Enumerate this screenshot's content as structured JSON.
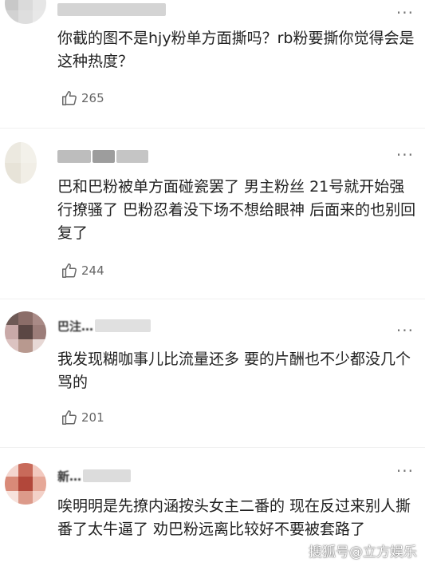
{
  "comments": [
    {
      "text": "你截的图不是hjy粉单方面撕吗？rb粉要撕你觉得会是这种热度？",
      "likes": "265"
    },
    {
      "text": "巴和巴粉被单方面碰瓷罢了 男主粉丝 21号就开始强行撩骚了 巴粉忍着没下场不想给眼神 后面来的也别回复了",
      "likes": "244"
    },
    {
      "name_partial": "巴注…",
      "text": "我发现糊咖事儿比流量还多 要的片酬也不少都没几个骂的",
      "likes": "201"
    },
    {
      "name_partial": "新…",
      "text": "唉明明是先撩内涵按头女主二番的 现在反过来别人撕番了太牛逼了 劝巴粉远离比较好不要被套路了",
      "likes": ""
    }
  ],
  "more_icon": "more-dots-icon",
  "like_icon": "thumbs-up-icon",
  "watermark": "搜狐号@立方娱乐"
}
